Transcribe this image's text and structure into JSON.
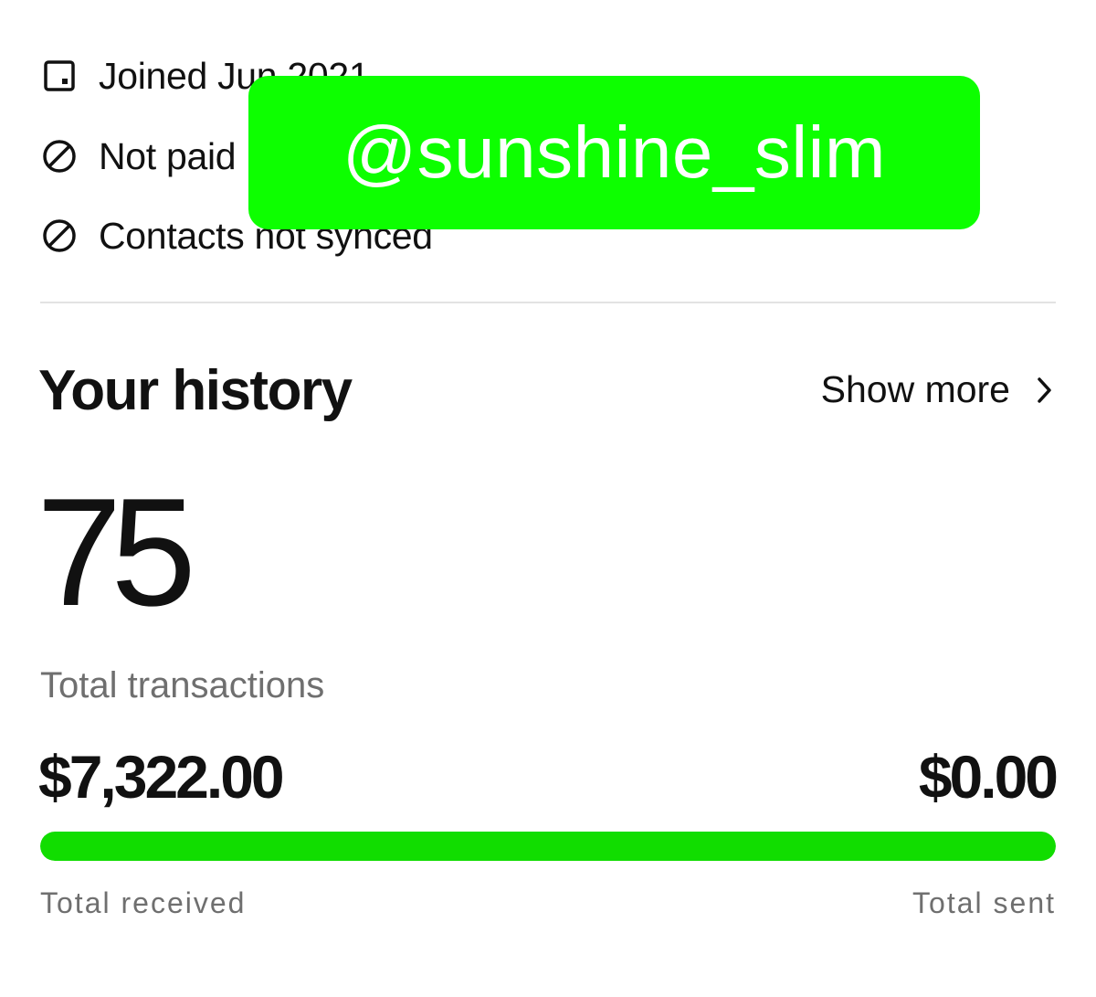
{
  "profile_info": {
    "joined": "Joined Jun 2021",
    "paid_status": "Not paid",
    "contacts_status": "Contacts not synced"
  },
  "overlay": {
    "username": "@sunshine_slim",
    "color": "#0dff00"
  },
  "history": {
    "title": "Your history",
    "show_more_label": "Show more",
    "transaction_count": "75",
    "transaction_label": "Total transactions",
    "total_received_amount": "$7,322.00",
    "total_sent_amount": "$0.00",
    "total_received_label": "Total received",
    "total_sent_label": "Total sent",
    "received_share": 1.0,
    "bar_color": "#11dd00"
  },
  "icons": {
    "joined": "calendar-icon",
    "paid": "prohibited-icon",
    "contacts": "prohibited-icon",
    "show_more": "chevron-right-icon"
  }
}
